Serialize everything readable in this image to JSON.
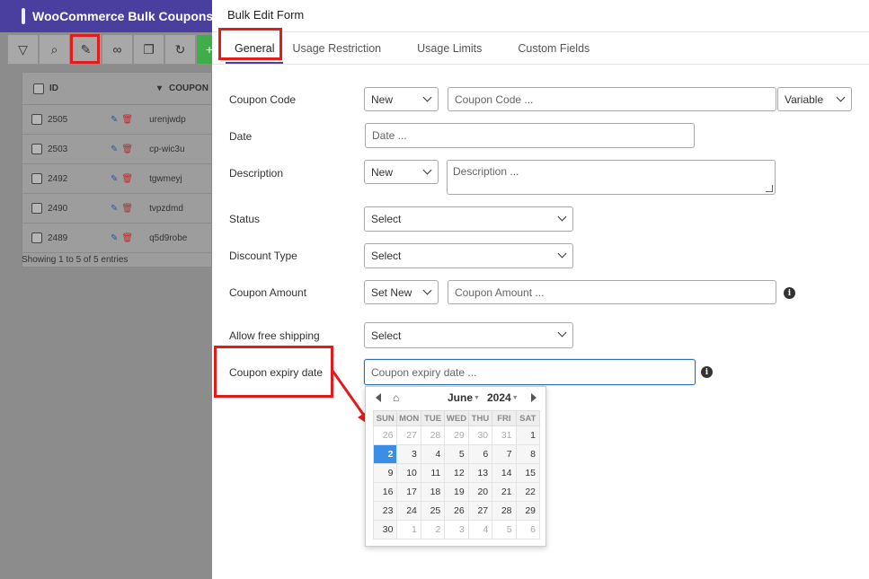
{
  "background": {
    "app_title": "WooCommerce Bulk Coupons",
    "table": {
      "headers": [
        "ID",
        "COUPON"
      ],
      "rows": [
        {
          "id": "2505",
          "code": "urenjwdp"
        },
        {
          "id": "2503",
          "code": "cp-wic3u"
        },
        {
          "id": "2492",
          "code": "tgwmeyj"
        },
        {
          "id": "2490",
          "code": "tvpzdmd"
        },
        {
          "id": "2489",
          "code": "q5d9robe"
        }
      ],
      "footer": "Showing 1 to 5 of 5 entries"
    }
  },
  "panel": {
    "title": "Bulk Edit Form",
    "tabs": [
      "General",
      "Usage Restriction",
      "Usage Limits",
      "Custom Fields"
    ],
    "fields": {
      "coupon_code": {
        "label": "Coupon Code",
        "mode": "New",
        "placeholder": "Coupon Code ...",
        "type": "Variable"
      },
      "date": {
        "label": "Date",
        "placeholder": "Date ..."
      },
      "description": {
        "label": "Description",
        "mode": "New",
        "placeholder": "Description ..."
      },
      "status": {
        "label": "Status",
        "value": "Select"
      },
      "discount_type": {
        "label": "Discount Type",
        "value": "Select"
      },
      "coupon_amount": {
        "label": "Coupon Amount",
        "mode": "Set New",
        "placeholder": "Coupon Amount ..."
      },
      "free_shipping": {
        "label": "Allow free shipping",
        "value": "Select"
      },
      "expiry": {
        "label": "Coupon expiry date",
        "placeholder": "Coupon expiry date ..."
      }
    },
    "info_icon": "i"
  },
  "calendar": {
    "month": "June",
    "year": "2024",
    "weekdays": [
      "SUN",
      "MON",
      "TUE",
      "WED",
      "THU",
      "FRI",
      "SAT"
    ],
    "weeks": [
      [
        "26",
        "27",
        "28",
        "29",
        "30",
        "31",
        "1"
      ],
      [
        "2",
        "3",
        "4",
        "5",
        "6",
        "7",
        "8"
      ],
      [
        "9",
        "10",
        "11",
        "12",
        "13",
        "14",
        "15"
      ],
      [
        "16",
        "17",
        "18",
        "19",
        "20",
        "21",
        "22"
      ],
      [
        "23",
        "24",
        "25",
        "26",
        "27",
        "28",
        "29"
      ],
      [
        "30",
        "1",
        "2",
        "3",
        "4",
        "5",
        "6"
      ]
    ],
    "selected": "2"
  },
  "colors": {
    "accent": "#4a3f9f",
    "highlight": "#e21b1b",
    "today": "#3a8ee6"
  }
}
